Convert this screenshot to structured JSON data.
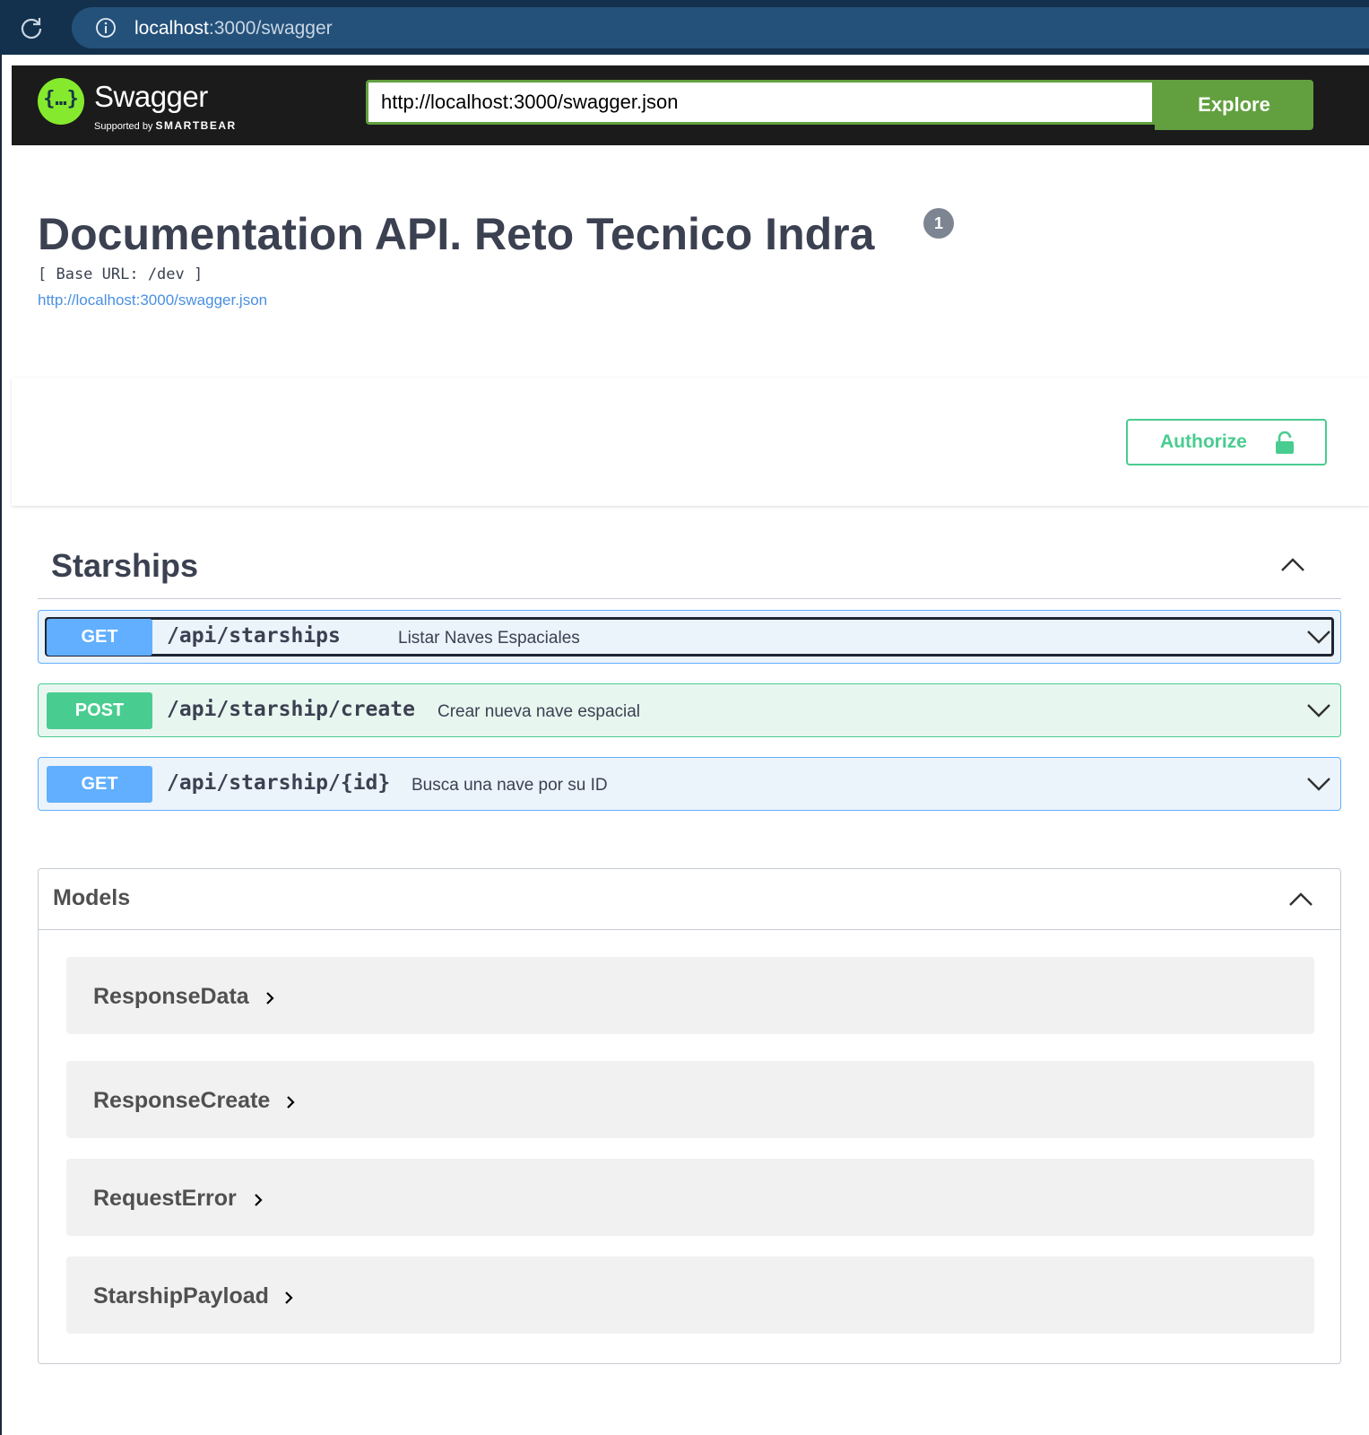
{
  "browser": {
    "url_host": "localhost",
    "url_rest": ":3000/swagger"
  },
  "topbar": {
    "logo_name": "Swagger",
    "logo_glyph": "{…}",
    "logo_supported": "Supported by",
    "logo_company": "SMARTBEAR",
    "spec_url": "http://localhost:3000/swagger.json",
    "explore_label": "Explore",
    "accent_color": "#62a03f"
  },
  "info": {
    "title": "Documentation API. Reto Tecnico Indra",
    "version_badge": "1",
    "base_url": "[ Base URL: /dev ]",
    "spec_link": "http://localhost:3000/swagger.json"
  },
  "authorize": {
    "label": "Authorize",
    "color": "#49cc90"
  },
  "tag": {
    "name": "Starships",
    "expanded": true,
    "operations": [
      {
        "method": "GET",
        "path": "/api/starships",
        "summary": "Listar Naves Espaciales",
        "color": "#61affe"
      },
      {
        "method": "POST",
        "path": "/api/starship/create",
        "summary": "Crear nueva nave espacial",
        "color": "#49cc90"
      },
      {
        "method": "GET",
        "path": "/api/starship/{id}",
        "summary": "Busca una nave por su ID",
        "color": "#61affe"
      }
    ]
  },
  "models": {
    "title": "Models",
    "expanded": true,
    "items": [
      "ResponseData",
      "ResponseCreate",
      "RequestError",
      "StarshipPayload"
    ]
  }
}
